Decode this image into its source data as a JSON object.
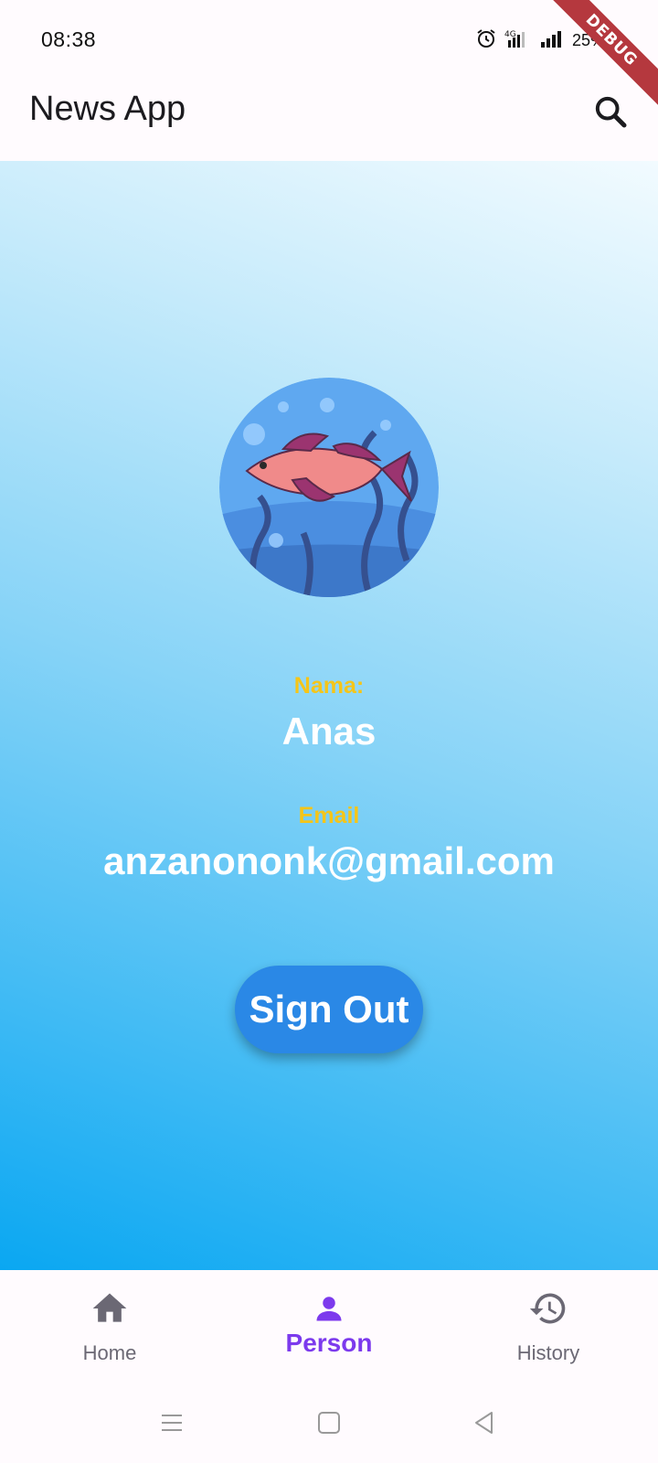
{
  "status_bar": {
    "time": "08:38",
    "battery": "25%",
    "icons": [
      "alarm-icon",
      "network-4g-icon",
      "signal-icon",
      "battery-icon"
    ]
  },
  "debug_banner": "DEBUG",
  "app_bar": {
    "title": "News App",
    "search_icon": "search-icon"
  },
  "profile": {
    "name_label": "Nama:",
    "name_value": "Anas",
    "email_label": "Email",
    "email_value": "anzanononk@gmail.com",
    "sign_out_label": "Sign Out"
  },
  "bottom_nav": {
    "items": [
      {
        "label": "Home",
        "icon": "home-icon",
        "active": false
      },
      {
        "label": "Person",
        "icon": "person-icon",
        "active": true
      },
      {
        "label": "History",
        "icon": "history-icon",
        "active": false
      }
    ]
  },
  "system_nav": [
    "menu-icon",
    "home-square-icon",
    "back-icon"
  ],
  "colors": {
    "accent": "#7c3aed",
    "label_yellow": "#f5c518",
    "button_blue": "#2a88e6",
    "debug_red": "#b5383e"
  }
}
